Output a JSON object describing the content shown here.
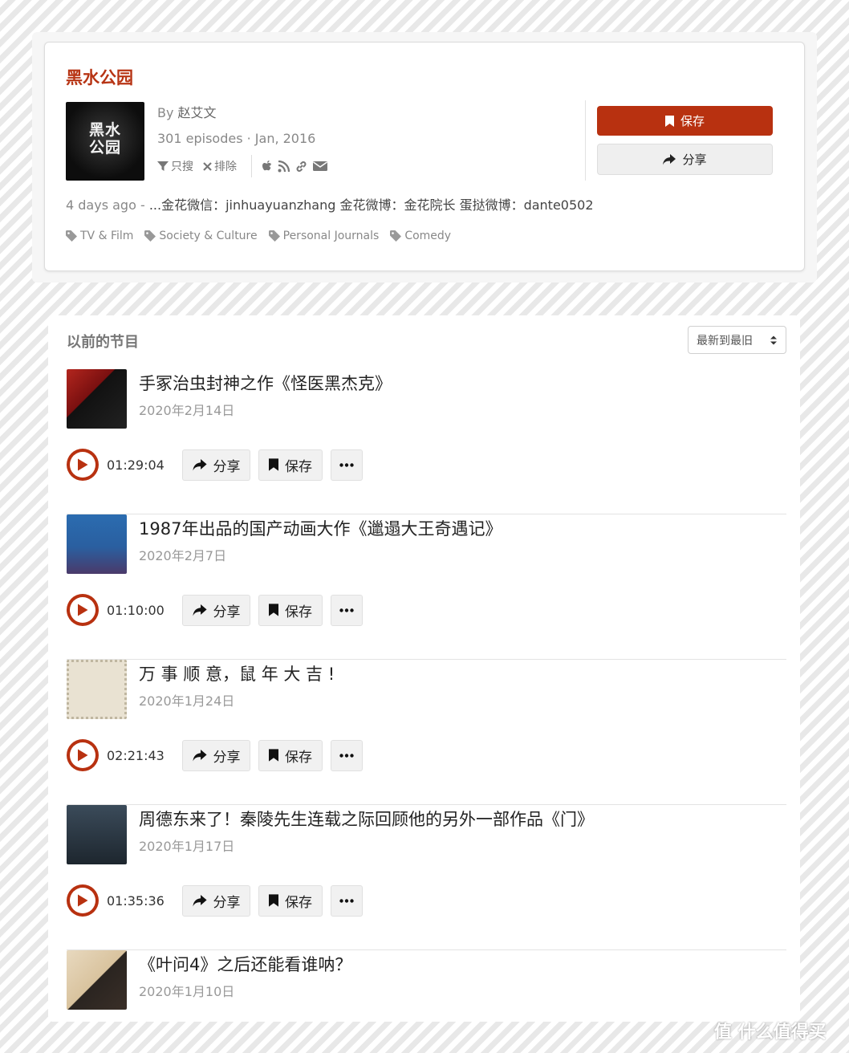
{
  "podcast": {
    "title": "黑水公园",
    "cover_text": "黑水\n公园",
    "author_prefix": "By",
    "author": "赵艾文",
    "episodes_info": "301 episodes · Jan, 2016",
    "filter_only": "只搜",
    "filter_exclude": "排除",
    "icons": [
      "filter-icon",
      "times-icon",
      "apple-icon",
      "rss-icon",
      "link-icon",
      "envelope-icon"
    ],
    "save_label": "保存",
    "share_label": "分享",
    "description_ago": "4 days ago",
    "description_text": "...金花微信：jinhuayuanzhang 金花微博：金花院长 蛋挞微博：dante0502",
    "tags": [
      "TV & Film",
      "Society & Culture",
      "Personal Journals",
      "Comedy"
    ]
  },
  "episodes_section": {
    "title": "以前的节目",
    "sort_value": "最新到最旧"
  },
  "controls": {
    "share_label": "分享",
    "save_label": "保存",
    "more_icon": "ellipsis-icon"
  },
  "episodes": [
    {
      "title": "手冢治虫封神之作《怪医黑杰克》",
      "date": "2020年2月14日",
      "duration": "01:29:04"
    },
    {
      "title": "1987年出品的国产动画大作《邋遢大王奇遇记》",
      "date": "2020年2月7日",
      "duration": "01:10:00"
    },
    {
      "title": "万 事 顺 意，鼠 年 大 吉 !",
      "date": "2020年1月24日",
      "duration": "02:21:43"
    },
    {
      "title": "周德东来了！秦陵先生连载之际回顾他的另外一部作品《门》",
      "date": "2020年1月17日",
      "duration": "01:35:36"
    },
    {
      "title": "《叶问4》之后还能看谁呐？",
      "date": "2020年1月10日",
      "duration": ""
    }
  ],
  "watermark": "值 什么值得买",
  "colors": {
    "accent": "#b83110",
    "title_red": "#b73414"
  }
}
